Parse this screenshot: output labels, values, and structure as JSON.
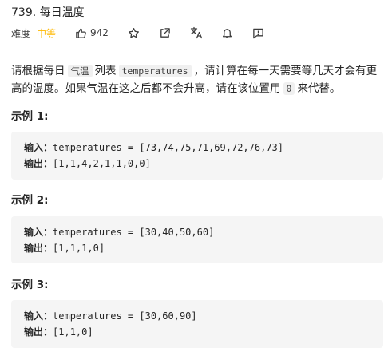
{
  "problem": {
    "title": "739. 每日温度",
    "difficulty_label": "难度",
    "difficulty": "中等",
    "likes": "942"
  },
  "description": {
    "t1": "请根据每日",
    "c1": "气温",
    "t2": "列表",
    "c2": "temperatures",
    "t3": "，请计算在每一天需要等几天才会有更高的温度。如果气温在这之后都不会升高，请在该位置用",
    "c3": "0",
    "t4": "来代替。"
  },
  "examples": [
    {
      "heading": "示例 1:",
      "input_label": "输入：",
      "input": "temperatures = [73,74,75,71,69,72,76,73]",
      "output_label": "输出：",
      "output": "[1,1,4,2,1,1,0,0]"
    },
    {
      "heading": "示例 2:",
      "input_label": "输入：",
      "input": "temperatures = [30,40,50,60]",
      "output_label": "输出：",
      "output": "[1,1,1,0]"
    },
    {
      "heading": "示例 3:",
      "input_label": "输入：",
      "input": "temperatures = [30,60,90]",
      "output_label": "输出：",
      "output": "[1,1,0]"
    }
  ],
  "icons": [
    "thumbs-up-icon",
    "star-icon",
    "share-icon",
    "translate-icon",
    "bell-icon",
    "feedback-icon"
  ],
  "colors": {
    "difficulty_medium": "#ffb800",
    "code_bg": "#f5f5f5",
    "inline_code_bg": "#f0f0f0"
  }
}
